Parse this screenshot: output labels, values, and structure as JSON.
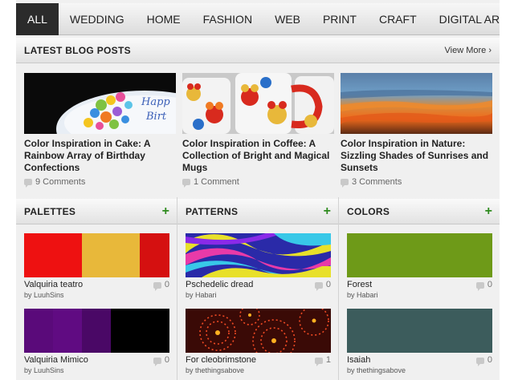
{
  "nav": {
    "items": [
      {
        "label": "ALL",
        "active": true
      },
      {
        "label": "WEDDING"
      },
      {
        "label": "HOME"
      },
      {
        "label": "FASHION"
      },
      {
        "label": "WEB"
      },
      {
        "label": "PRINT"
      },
      {
        "label": "CRAFT"
      },
      {
        "label": "DIGITAL ART"
      }
    ]
  },
  "blog": {
    "title": "LATEST BLOG POSTS",
    "view_more": "View More ›",
    "posts": [
      {
        "title": "Color Inspiration in Cake: A Rainbow Array of Birthday Confections",
        "comments": "9 Comments"
      },
      {
        "title": "Color Inspiration in Coffee: A Collection of Bright and Magical Mugs",
        "comments": "1 Comment"
      },
      {
        "title": "Color Inspiration in Nature: Sizzling Shades of Sunrises and Sunsets",
        "comments": "3 Comments"
      }
    ]
  },
  "palettes": {
    "title": "PALETTES",
    "add": "+",
    "items": [
      {
        "name": "Valquiria teatro",
        "count": "0",
        "by": "by LuuhSins",
        "colors": [
          "#ee1111",
          "#e8b83a",
          "#e8b83a",
          "#d51010"
        ]
      },
      {
        "name": "Valquiria Mimico",
        "count": "0",
        "by": "by LuuhSins",
        "colors": [
          "#5a0a7a",
          "#600b82",
          "#4a0866",
          "#000000"
        ]
      }
    ]
  },
  "patterns": {
    "title": "PATTERNS",
    "add": "+",
    "items": [
      {
        "name": "Pschedelic dread",
        "count": "0",
        "by": "by Habari"
      },
      {
        "name": "For cleobrimstone",
        "count": "1",
        "by": "by thethingsabove"
      }
    ]
  },
  "colors": {
    "title": "COLORS",
    "add": "+",
    "items": [
      {
        "name": "Forest",
        "count": "0",
        "by": "by Habari",
        "color": "#6e9a18"
      },
      {
        "name": "Isaiah",
        "count": "0",
        "by": "by thethingsabove",
        "color": "#3c5c5c"
      }
    ]
  },
  "accent": {
    "plus_green": "#2e8b1e",
    "nav_active": "#2b2b2b"
  }
}
